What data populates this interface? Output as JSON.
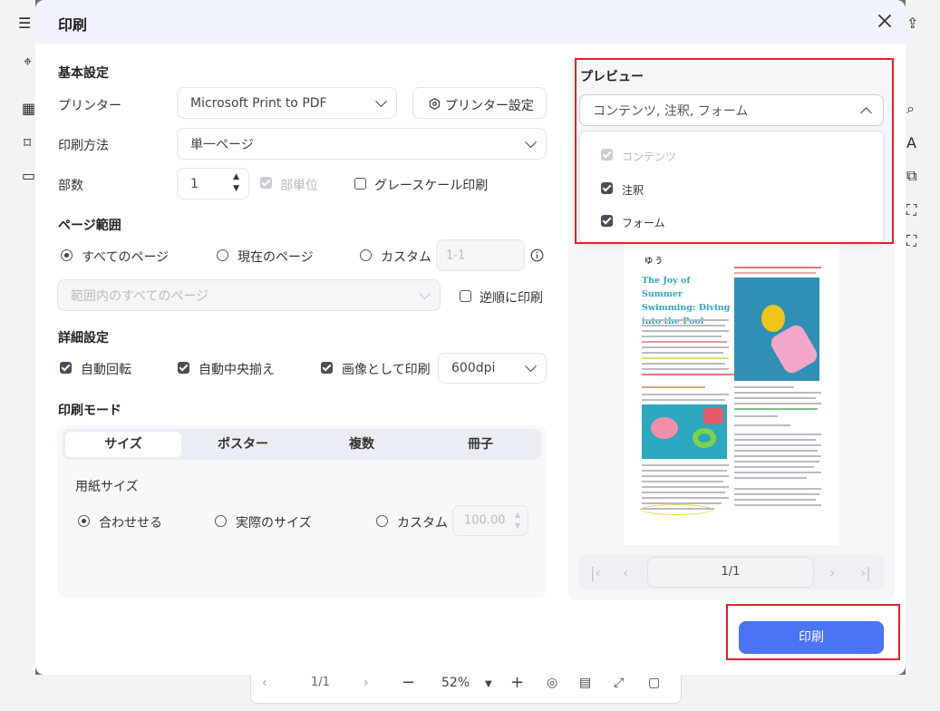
{
  "dialog": {
    "title": "印刷"
  },
  "basic": {
    "section_title": "基本設定",
    "printer_label": "プリンター",
    "printer_value": "Microsoft Print to PDF",
    "printer_settings_button": "プリンター設定",
    "method_label": "印刷方法",
    "method_value": "単一ページ",
    "copies_label": "部数",
    "copies_value": "1",
    "collate_label": "部単位",
    "grayscale_label": "グレースケール印刷"
  },
  "page_range": {
    "section_title": "ページ範囲",
    "options": [
      "すべてのページ",
      "現在のページ",
      "カスタム"
    ],
    "selected": "すべてのページ",
    "custom_placeholder": "1-1",
    "subset_value": "範囲内のすべてのページ",
    "reverse_label": "逆順に印刷"
  },
  "advanced": {
    "section_title": "詳細設定",
    "auto_rotate": "自動回転",
    "auto_center": "自動中央揃え",
    "print_as_image": "画像として印刷",
    "dpi_value": "600dpi"
  },
  "print_mode": {
    "section_title": "印刷モード",
    "tabs": [
      "サイズ",
      "ポスター",
      "複数",
      "冊子"
    ],
    "active_tab": "サイズ",
    "paper_size_label": "用紙サイズ",
    "size_options": [
      "合わせせる",
      "実際のサイズ",
      "カスタム"
    ],
    "selected": "合わせせる",
    "custom_value": "100.00"
  },
  "preview": {
    "title": "プレビュー",
    "content_select_value": "コンテンツ, 注釈, フォーム",
    "dropdown_items": [
      {
        "label": "コンテンツ",
        "checked": true,
        "disabled": true
      },
      {
        "label": "注釈",
        "checked": true,
        "disabled": false
      },
      {
        "label": "フォーム",
        "checked": true,
        "disabled": false
      }
    ],
    "document": {
      "title": "The Joy of Summer Swimming: Diving into the Pool"
    },
    "page_indicator": "1/1"
  },
  "print_button": "印刷",
  "background": {
    "page_display": "1/1",
    "zoom": "52%"
  },
  "colors": {
    "accent": "#4a73f5",
    "highlight_red": "#e02424"
  }
}
